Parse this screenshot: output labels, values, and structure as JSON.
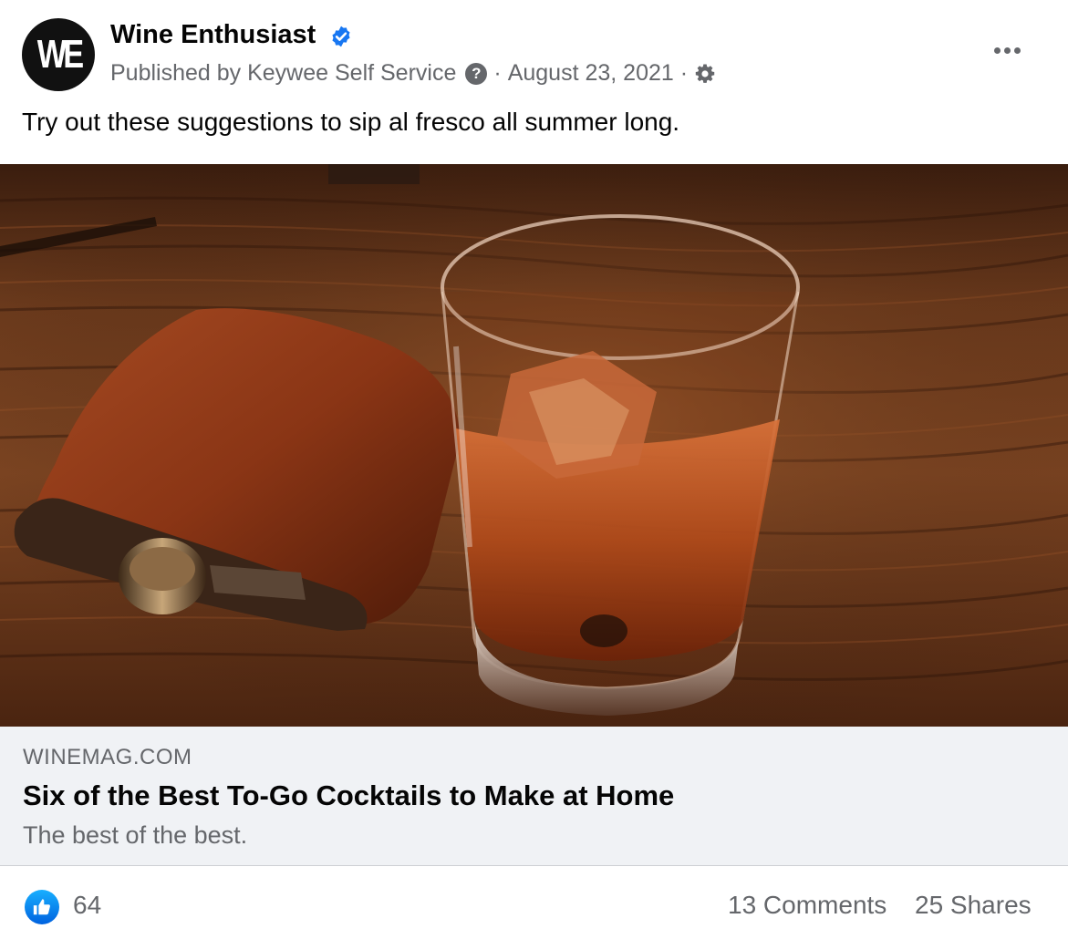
{
  "post": {
    "avatar_text": "WE",
    "page_name": "Wine Enthusiast",
    "published_by": "Published by Keywee Self Service",
    "help_icon": "?",
    "separator": "·",
    "date": "August 23, 2021",
    "caption": "Try out these suggestions to sip al fresco all summer long."
  },
  "link": {
    "domain": "WINEMAG.COM",
    "title": "Six of the Best To-Go Cocktails to Make at Home",
    "description": "The best of the best."
  },
  "stats": {
    "likes": "64",
    "comments": "13 Comments",
    "shares": "25 Shares"
  },
  "icons": {
    "verified": "verified-badge-icon",
    "audience": "gear-icon",
    "more": "more-options-icon",
    "like": "thumbs-up-icon"
  },
  "colors": {
    "accent": "#1877f2",
    "secondary_text": "#65676b",
    "link_background": "#f0f2f5"
  }
}
